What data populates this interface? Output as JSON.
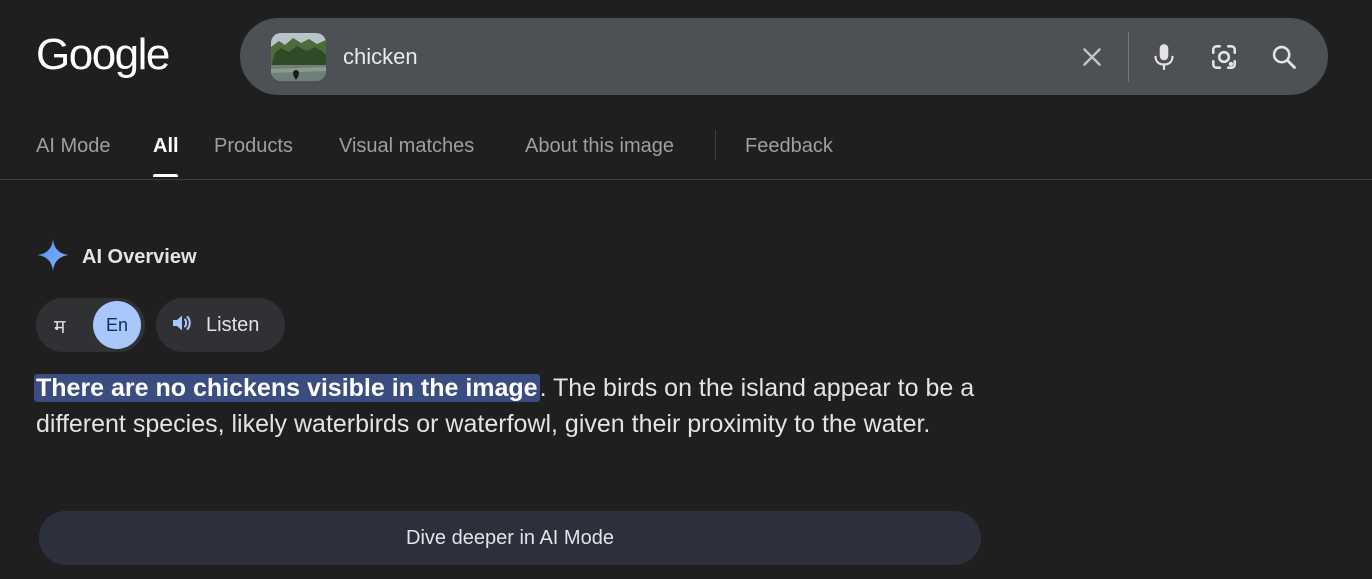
{
  "header": {
    "logo": "Google"
  },
  "search": {
    "query": "chicken",
    "thumbnail_icon": "uploaded-image-thumbnail",
    "icons": [
      "close-icon",
      "mic-icon",
      "lens-icon",
      "search-icon"
    ]
  },
  "tabs": [
    {
      "label": "AI Mode",
      "active": false
    },
    {
      "label": "All",
      "active": true
    },
    {
      "label": "Products",
      "active": false
    },
    {
      "label": "Visual matches",
      "active": false
    },
    {
      "label": "About this image",
      "active": false
    },
    {
      "label": "Feedback",
      "active": false
    }
  ],
  "overview": {
    "title": "AI Overview",
    "lang_options": [
      "म",
      "En"
    ],
    "selected_lang": "En",
    "listen_label": "Listen",
    "answer_highlight": "There are no chickens visible in the image",
    "answer_rest": ". The birds on the island appear to be a different species, likely waterbirds or waterfowl, given their proximity to the water.",
    "dive_label": "Dive deeper in AI Mode"
  },
  "colors": {
    "background": "#1f1f1f",
    "search_bar": "#4d5156",
    "highlight": "#3b4d80",
    "accent_blue": "#a8c7fa",
    "sparkle": "#4c8df6"
  }
}
